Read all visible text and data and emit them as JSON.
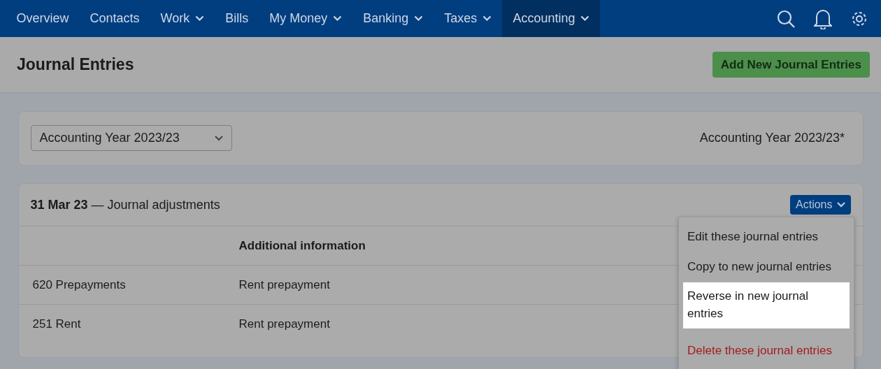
{
  "nav": {
    "items": [
      {
        "label": "Overview",
        "dropdown": false,
        "selected": false
      },
      {
        "label": "Contacts",
        "dropdown": false,
        "selected": false
      },
      {
        "label": "Work",
        "dropdown": true,
        "selected": false
      },
      {
        "label": "Bills",
        "dropdown": false,
        "selected": false
      },
      {
        "label": "My Money",
        "dropdown": true,
        "selected": false
      },
      {
        "label": "Banking",
        "dropdown": true,
        "selected": false
      },
      {
        "label": "Taxes",
        "dropdown": true,
        "selected": false
      },
      {
        "label": "Accounting",
        "dropdown": true,
        "selected": true
      }
    ]
  },
  "page": {
    "title": "Journal Entries",
    "add_button": "Add New Journal Entries"
  },
  "year_card": {
    "select_value": "Accounting Year 2023/23",
    "label": "Accounting Year 2023/23*"
  },
  "entry": {
    "date": "31 Mar 23",
    "description": " — Journal adjustments",
    "actions_button": "Actions",
    "columns": [
      "",
      "Additional information"
    ],
    "rows": [
      [
        "620 Prepayments",
        "Rent prepayment"
      ],
      [
        "251 Rent",
        "Rent prepayment"
      ]
    ]
  },
  "menu": {
    "items": [
      {
        "label": "Edit these journal entries",
        "kind": "normal",
        "selected": false
      },
      {
        "label": "Copy to new journal entries",
        "kind": "normal",
        "selected": false
      },
      {
        "label": "Reverse in new journal entries",
        "kind": "normal",
        "selected": true
      },
      {
        "label": "Delete these journal entries",
        "kind": "danger",
        "selected": false
      }
    ]
  }
}
